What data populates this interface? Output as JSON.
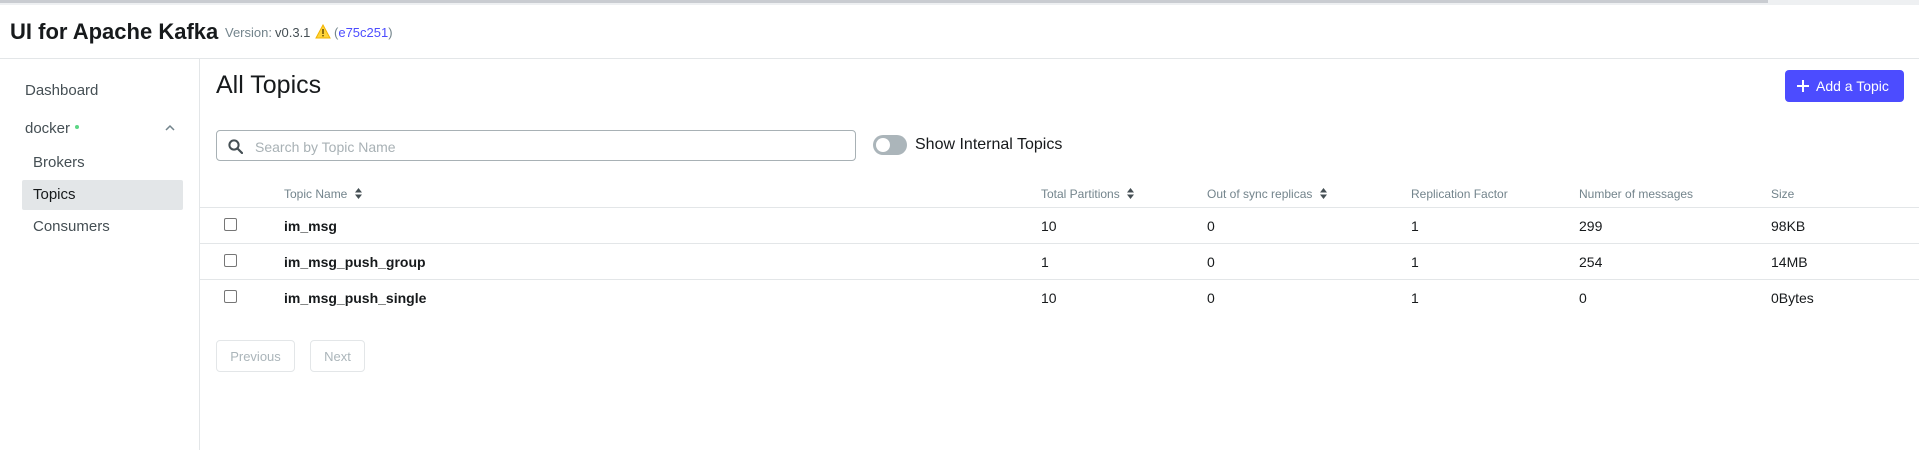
{
  "app": {
    "title": "UI for Apache Kafka",
    "version_label": "Version:",
    "version": "v0.3.1",
    "commit": "e75c251"
  },
  "sidebar": {
    "dashboard": "Dashboard",
    "cluster": "docker",
    "items": [
      "Brokers",
      "Topics",
      "Consumers"
    ],
    "active": "Topics",
    "status_color": "#5cd685"
  },
  "main": {
    "title": "All Topics",
    "add_button": "Add a Topic",
    "search_placeholder": "Search by Topic Name",
    "search_value": "",
    "toggle_label": "Show Internal Topics",
    "show_internal": false,
    "accent_color": "#4c4cff"
  },
  "table": {
    "headers": [
      "Topic Name",
      "Total Partitions",
      "Out of sync replicas",
      "Replication Factor",
      "Number of messages",
      "Size"
    ],
    "rows": [
      {
        "name": "im_msg",
        "partitions": "10",
        "out_of_sync": "0",
        "replication": "1",
        "messages": "299",
        "size": "98KB"
      },
      {
        "name": "im_msg_push_group",
        "partitions": "1",
        "out_of_sync": "0",
        "replication": "1",
        "messages": "254",
        "size": "14MB"
      },
      {
        "name": "im_msg_push_single",
        "partitions": "10",
        "out_of_sync": "0",
        "replication": "1",
        "messages": "0",
        "size": "0Bytes"
      }
    ]
  },
  "pagination": {
    "previous": "Previous",
    "next": "Next"
  }
}
